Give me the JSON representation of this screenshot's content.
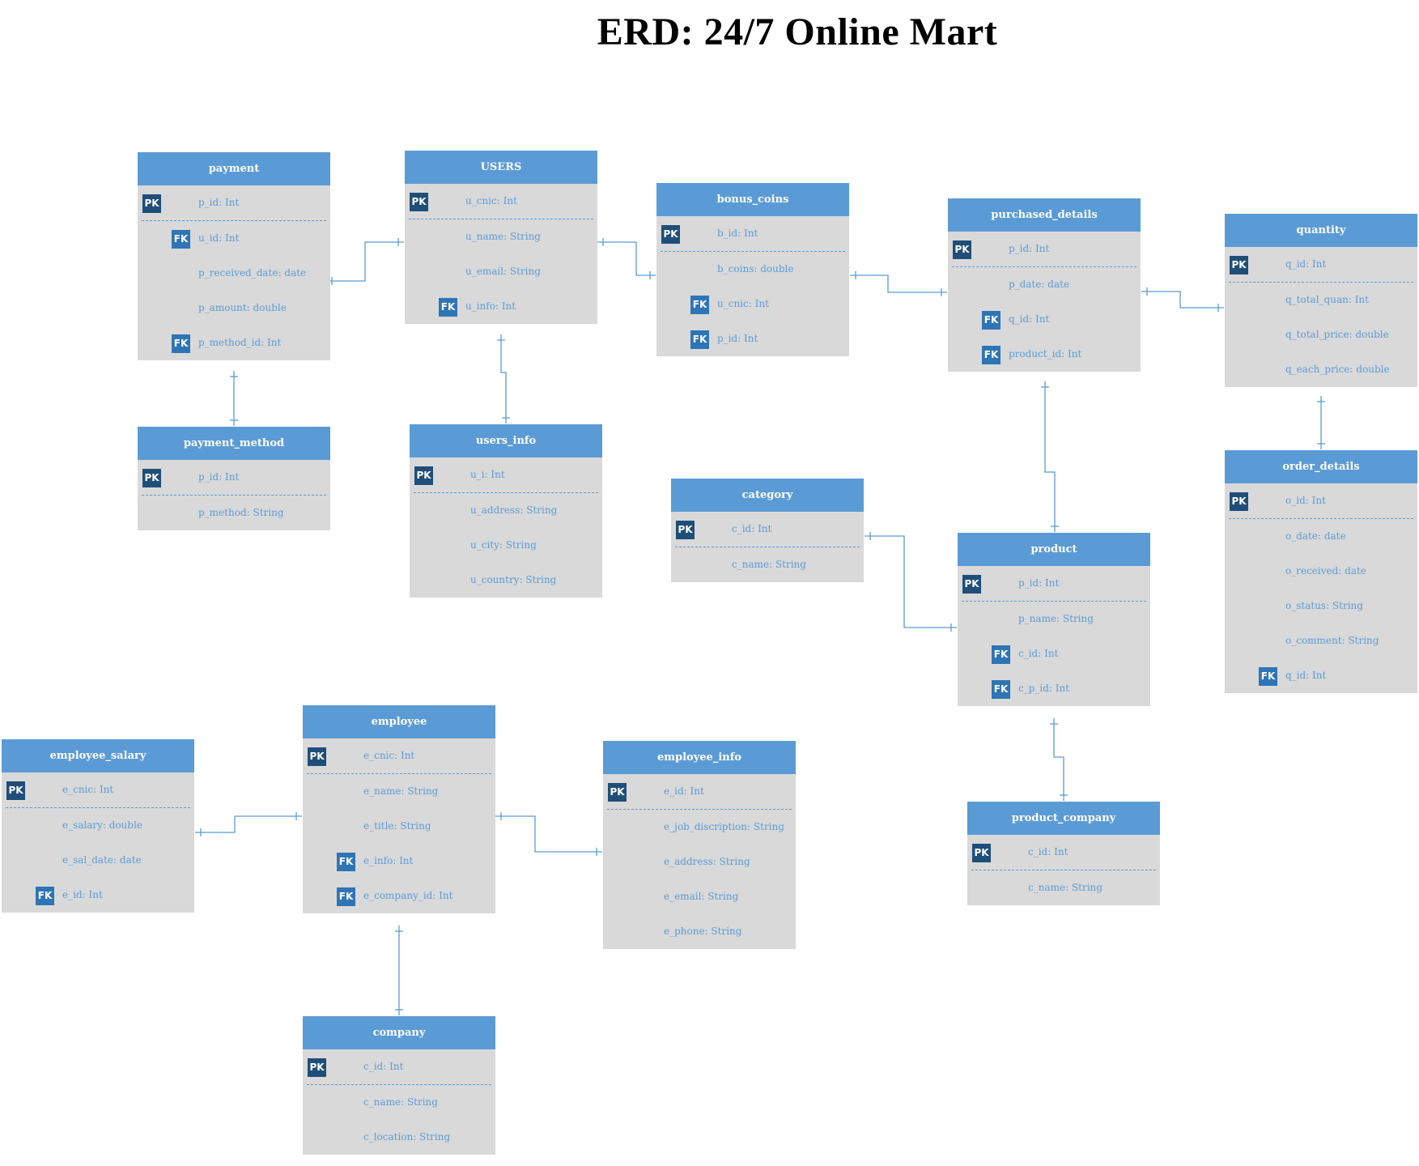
{
  "title": "ERD: 24/7 Online Mart",
  "entities": [
    {
      "id": "payment",
      "name": "payment",
      "attributes": [
        {
          "key": "PK",
          "text": "p_id: Int"
        },
        {
          "key": "FK",
          "text": "u_id: Int"
        },
        {
          "key": "",
          "text": "p_received_date: date"
        },
        {
          "key": "",
          "text": "p_amount: double"
        },
        {
          "key": "FK",
          "text": "p_method_id: Int"
        }
      ]
    },
    {
      "id": "users",
      "name": "USERS",
      "attributes": [
        {
          "key": "PK",
          "text": "u_cnic: Int"
        },
        {
          "key": "",
          "text": "u_name: String"
        },
        {
          "key": "",
          "text": "u_email: String"
        },
        {
          "key": "FK",
          "text": "u_info: Int"
        }
      ]
    },
    {
      "id": "bonus_coins",
      "name": "bonus_coins",
      "attributes": [
        {
          "key": "PK",
          "text": "b_id: Int"
        },
        {
          "key": "",
          "text": "b_coins: double"
        },
        {
          "key": "FK",
          "text": "u_cnic: Int"
        },
        {
          "key": "FK",
          "text": "p_id: Int"
        }
      ]
    },
    {
      "id": "purchased_details",
      "name": "purchased_details",
      "attributes": [
        {
          "key": "PK",
          "text": "p_id: Int"
        },
        {
          "key": "",
          "text": "p_date: date"
        },
        {
          "key": "FK",
          "text": "q_id: Int"
        },
        {
          "key": "FK",
          "text": "product_id: Int"
        }
      ]
    },
    {
      "id": "quantity",
      "name": "quantity",
      "attributes": [
        {
          "key": "PK",
          "text": "q_id: Int"
        },
        {
          "key": "",
          "text": "q_total_quan: Int"
        },
        {
          "key": "",
          "text": "q_total_price: double"
        },
        {
          "key": "",
          "text": "q_each_price: double"
        }
      ]
    },
    {
      "id": "payment_method",
      "name": "payment_method",
      "attributes": [
        {
          "key": "PK",
          "text": "p_id: Int"
        },
        {
          "key": "",
          "text": "p_method: String"
        }
      ]
    },
    {
      "id": "users_info",
      "name": "users_info",
      "attributes": [
        {
          "key": "PK",
          "text": "u_i: Int"
        },
        {
          "key": "",
          "text": "u_address: String"
        },
        {
          "key": "",
          "text": "u_city: String"
        },
        {
          "key": "",
          "text": "u_country: String"
        }
      ]
    },
    {
      "id": "category",
      "name": "category",
      "attributes": [
        {
          "key": "PK",
          "text": "c_id: Int"
        },
        {
          "key": "",
          "text": "c_name: String"
        }
      ]
    },
    {
      "id": "order_details",
      "name": "order_details",
      "attributes": [
        {
          "key": "PK",
          "text": "o_id: Int"
        },
        {
          "key": "",
          "text": "o_date: date"
        },
        {
          "key": "",
          "text": "o_received: date"
        },
        {
          "key": "",
          "text": "o_status: String"
        },
        {
          "key": "",
          "text": "o_comment: String"
        },
        {
          "key": "FK",
          "text": "q_id: Int"
        }
      ]
    },
    {
      "id": "product",
      "name": "product",
      "attributes": [
        {
          "key": "PK",
          "text": "p_id: Int"
        },
        {
          "key": "",
          "text": "p_name: String"
        },
        {
          "key": "FK",
          "text": "c_id: Int"
        },
        {
          "key": "FK",
          "text": "c_p_id: Int"
        }
      ]
    },
    {
      "id": "employee",
      "name": "employee",
      "attributes": [
        {
          "key": "PK",
          "text": "e_cnic: Int"
        },
        {
          "key": "",
          "text": "e_name: String"
        },
        {
          "key": "",
          "text": "e_title: String"
        },
        {
          "key": "FK",
          "text": "e_info: Int"
        },
        {
          "key": "FK",
          "text": "e_company_id: Int"
        }
      ]
    },
    {
      "id": "employee_salary",
      "name": "employee_salary",
      "attributes": [
        {
          "key": "PK",
          "text": "e_cnic: Int"
        },
        {
          "key": "",
          "text": "e_salary: double"
        },
        {
          "key": "",
          "text": "e_sal_date: date"
        },
        {
          "key": "FK",
          "text": "e_id: Int"
        }
      ]
    },
    {
      "id": "employee_info",
      "name": "employee_info",
      "attributes": [
        {
          "key": "PK",
          "text": "e_id: Int"
        },
        {
          "key": "",
          "text": "e_job_discription: String"
        },
        {
          "key": "",
          "text": "e_address: String"
        },
        {
          "key": "",
          "text": "e_email: String"
        },
        {
          "key": "",
          "text": "e_phone: String"
        }
      ]
    },
    {
      "id": "product_company",
      "name": "product_company",
      "attributes": [
        {
          "key": "PK",
          "text": "c_id: Int"
        },
        {
          "key": "",
          "text": "c_name: String"
        }
      ]
    },
    {
      "id": "company",
      "name": "company",
      "attributes": [
        {
          "key": "PK",
          "text": "c_id: Int"
        },
        {
          "key": "",
          "text": "c_name: String"
        },
        {
          "key": "",
          "text": "c_location: String"
        }
      ]
    }
  ],
  "relationships": [
    {
      "from": "users",
      "from_end": "one",
      "to": "payment",
      "to_end": "many"
    },
    {
      "from": "users",
      "from_end": "one",
      "to": "bonus_coins",
      "to_end": "zero-or-many"
    },
    {
      "from": "bonus_coins",
      "from_end": "one",
      "to": "purchased_details",
      "to_end": "zero-or-many"
    },
    {
      "from": "purchased_details",
      "from_end": "one",
      "to": "quantity",
      "to_end": "many"
    },
    {
      "from": "payment",
      "from_end": "zero-or-many",
      "to": "payment_method",
      "to_end": "one"
    },
    {
      "from": "users",
      "from_end": "zero-or-one",
      "to": "users_info",
      "to_end": "one"
    },
    {
      "from": "quantity",
      "from_end": "many",
      "to": "order_details",
      "to_end": "one"
    },
    {
      "from": "purchased_details",
      "from_end": "one",
      "to": "product",
      "to_end": "one"
    },
    {
      "from": "category",
      "from_end": "one",
      "to": "product",
      "to_end": "zero-or-many"
    },
    {
      "from": "product",
      "from_end": "zero-or-many",
      "to": "product_company",
      "to_end": "one"
    },
    {
      "from": "employee_salary",
      "from_end": "zero-or-many",
      "to": "employee",
      "to_end": "one"
    },
    {
      "from": "employee",
      "from_end": "zero-or-many",
      "to": "employee_info",
      "to_end": "one"
    },
    {
      "from": "employee",
      "from_end": "many",
      "to": "company",
      "to_end": "one"
    }
  ],
  "colors": {
    "header": "#5b9bd5",
    "body": "#d9d9d9",
    "pk": "#1f4e79",
    "fk": "#2e75b6",
    "text": "#5b9bd5",
    "line": "#5b9bd5"
  }
}
